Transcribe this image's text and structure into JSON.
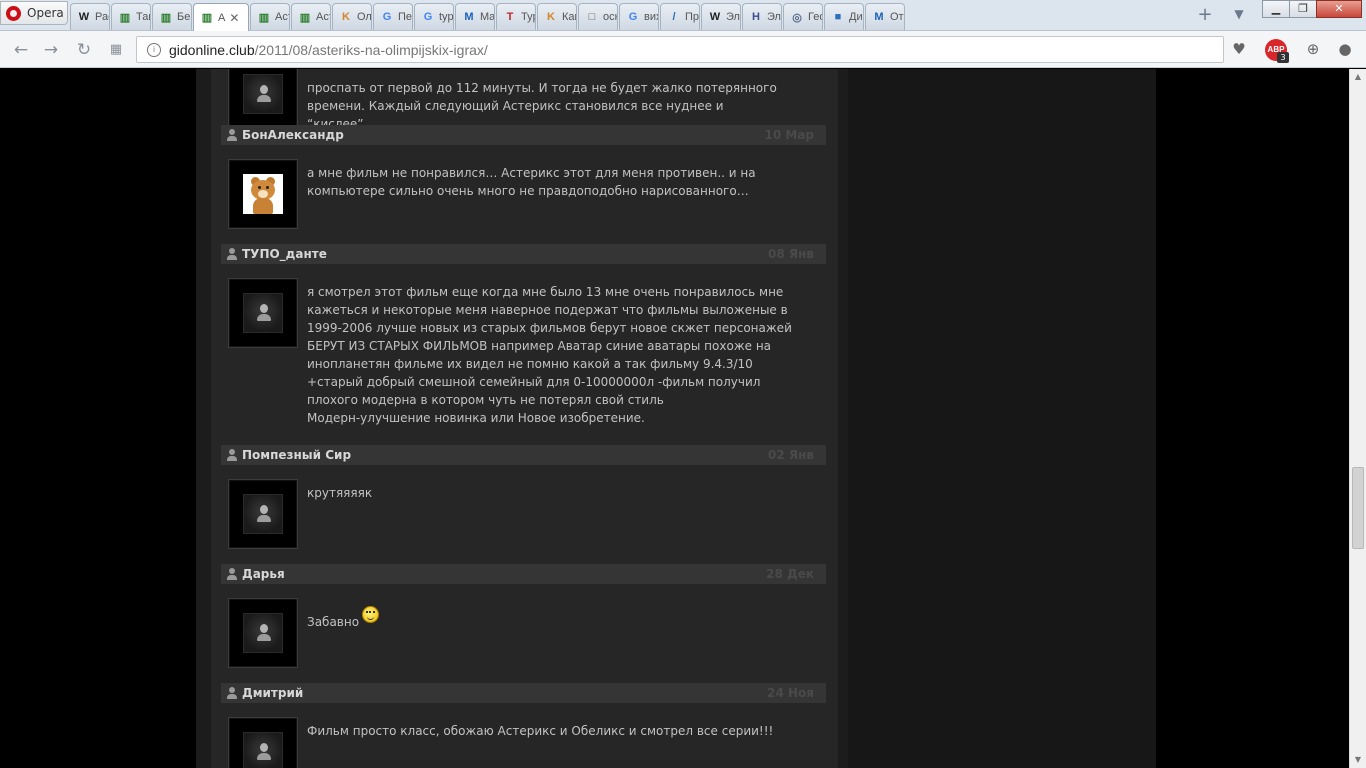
{
  "browser": {
    "opera_label": "Opera",
    "tabs": [
      {
        "label": "Рас",
        "icon": "W"
      },
      {
        "label": "Так",
        "icon": "▥"
      },
      {
        "label": "Бег",
        "icon": "▥"
      },
      {
        "label": "А",
        "icon": "▥",
        "active": true
      },
      {
        "label": "Асте",
        "icon": "▥"
      },
      {
        "label": "Асте",
        "icon": "▥"
      },
      {
        "label": "Ола",
        "icon": "K"
      },
      {
        "label": "Пер",
        "icon": "G"
      },
      {
        "label": "typo",
        "icon": "G"
      },
      {
        "label": "Mas",
        "icon": "M"
      },
      {
        "label": "Typ",
        "icon": "T"
      },
      {
        "label": "Как",
        "icon": "K"
      },
      {
        "label": "осн",
        "icon": "□"
      },
      {
        "label": "вих",
        "icon": "G"
      },
      {
        "label": "При",
        "icon": "/"
      },
      {
        "label": "Эле",
        "icon": "W"
      },
      {
        "label": "Эле",
        "icon": "H"
      },
      {
        "label": "Гео",
        "icon": "◎"
      },
      {
        "label": "Диа",
        "icon": "■"
      },
      {
        "label": "Отп",
        "icon": "M"
      }
    ],
    "url_domain": "gidonline.club",
    "url_path": "/2011/08/asteriks-na-olimpijskix-igrax/",
    "adblock_label": "ABP",
    "adblock_count": "3"
  },
  "comments": [
    {
      "name": "",
      "date": "",
      "text": "проспать от первой до 112 минуты. И тогда не будет жалко потерянного\nвремени. Каждый следующий Астерикс становился все нуднее и “кислее”…."
    },
    {
      "name": "БонАлександр",
      "date": "10 Мар",
      "text": "а мне фильм не понравился… Астерикс этот для меня противен.. и на\nкомпьютере сильно очень много не правдоподобно нарисованного…"
    },
    {
      "name": "ТУПО_данте",
      "date": "08 Янв",
      "text": "я смотрел этот фильм еще когда мне было 13 мне очень понравилось мне\nкажеться и некоторые меня наверное подержат что фильмы выложеные в\n1999-2006 лучше новых из старых фильмов берут новое скжет персонажей\nБЕРУТ ИЗ СТАРЫХ ФИЛЬМОВ например Аватар синие аватары похоже на\nинопланетян фильме их видел не помню какой а так фильму 9.4.3/10\n+старый добрый смешной семейный для 0-10000000л -фильм получил\nплохого модерна в котором чуть не потерял свой стиль\nМодерн-улучшение новинка или Новое изобретение."
    },
    {
      "name": "Помпезный Сир",
      "date": "02 Янв",
      "text": "крутяяяяк"
    },
    {
      "name": "Дарья",
      "date": "28 Дек",
      "text": "Забавно"
    },
    {
      "name": "Дмитрий",
      "date": "24 Ноя",
      "text": "Фильм просто класс, обожаю Астерикс и Обеликс и смотрел все серии!!!"
    }
  ]
}
